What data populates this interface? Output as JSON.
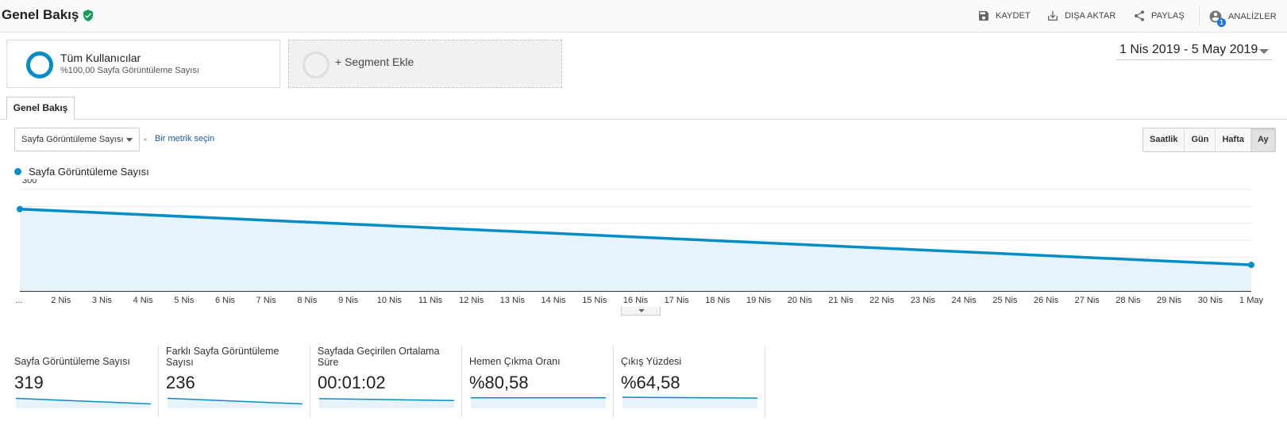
{
  "header": {
    "title": "Genel Bakış",
    "actions": {
      "save": "KAYDET",
      "export": "DIŞA AKTAR",
      "share": "PAYLAŞ",
      "insights": "ANALİZLER",
      "insights_badge": "1"
    }
  },
  "segments": {
    "active": {
      "name": "Tüm Kullanıcılar",
      "sub": "%100,00 Sayfa Görüntüleme Sayısı"
    },
    "add_label": "+ Segment Ekle"
  },
  "date_range": "1 Nis 2019 - 5 May 2019",
  "tabs": [
    {
      "label": "Genel Bakış",
      "active": true
    }
  ],
  "metric_selector": {
    "selected": "Sayfa Görüntüleme Sayısı",
    "separator": "-",
    "second_metric_link": "Bir metrik seçin"
  },
  "granularity": {
    "options": [
      "Saatlik",
      "Gün",
      "Hafta",
      "Ay"
    ],
    "active": "Ay"
  },
  "colors": {
    "series": "#058dc7",
    "area": "#e6f3fa",
    "link": "#1a5a96"
  },
  "chart_data": {
    "type": "area",
    "legend": "Sayfa Görüntüleme Sayısı",
    "y_ticks": [
      100,
      200,
      300
    ],
    "ylim": [
      0,
      300
    ],
    "x_tick_labels": [
      "...",
      "2 Nis",
      "3 Nis",
      "4 Nis",
      "5 Nis",
      "6 Nis",
      "7 Nis",
      "8 Nis",
      "9 Nis",
      "10 Nis",
      "11 Nis",
      "12 Nis",
      "13 Nis",
      "14 Nis",
      "15 Nis",
      "16 Nis",
      "17 Nis",
      "18 Nis",
      "19 Nis",
      "20 Nis",
      "21 Nis",
      "22 Nis",
      "23 Nis",
      "24 Nis",
      "25 Nis",
      "26 Nis",
      "27 Nis",
      "28 Nis",
      "29 Nis",
      "30 Nis",
      "1 May"
    ],
    "series": [
      {
        "name": "Sayfa Görüntüleme Sayısı",
        "points": [
          {
            "x": "1 Nis 2019",
            "y": 242
          },
          {
            "x": "1 May 2019",
            "y": 77
          }
        ]
      }
    ],
    "grid": true
  },
  "scorecards": [
    {
      "label": "Sayfa Görüntüleme Sayısı",
      "value": "319",
      "spark": [
        0.75,
        0.25
      ]
    },
    {
      "label": "Farklı Sayfa Görüntüleme Sayısı",
      "value": "236",
      "spark": [
        0.75,
        0.25
      ]
    },
    {
      "label": "Sayfada Geçirilen Ortalama Süre",
      "value": "00:01:02",
      "spark": [
        0.72,
        0.55
      ]
    },
    {
      "label": "Hemen Çıkma Oranı",
      "value": "%80,58",
      "spark": [
        0.8,
        0.8
      ]
    },
    {
      "label": "Çıkış Yüzdesi",
      "value": "%64,58",
      "spark": [
        0.85,
        0.78
      ]
    }
  ]
}
